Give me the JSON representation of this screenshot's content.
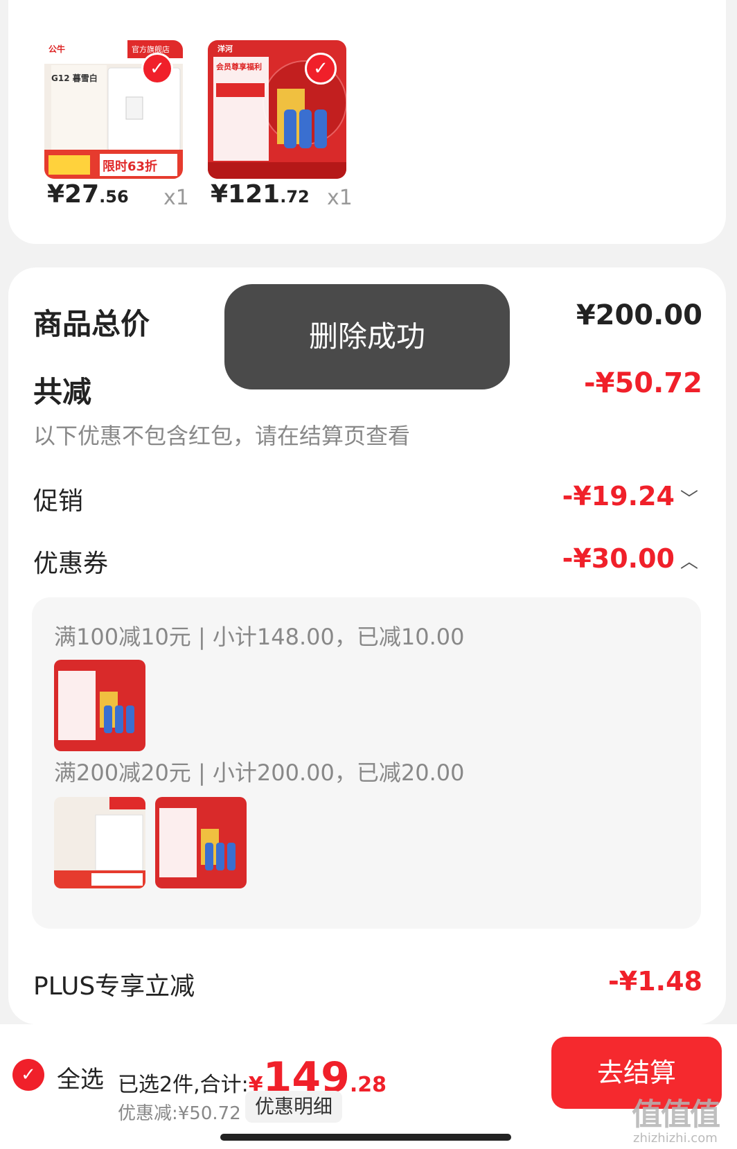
{
  "cart_items": [
    {
      "price_main": "¥27",
      "price_cents": ".56",
      "qty": "x1",
      "badge": "官方旗舰店",
      "brand": "公牛",
      "product_text": "G12 暮雪白",
      "promo_text": "限时63折"
    },
    {
      "price_main": "¥121",
      "price_cents": ".72",
      "qty": "x1",
      "brand": "洋河",
      "product_text": "会员尊享福利"
    }
  ],
  "summary": {
    "total_label": "商品总价",
    "total_value": "¥200.00",
    "reduce_label": "共减",
    "reduce_value": "-¥50.72",
    "hint": "以下优惠不包含红包，请在结算页查看",
    "promo_label": "促销",
    "promo_value": "-¥19.24",
    "coupon_label": "优惠券",
    "coupon_value": "-¥30.00",
    "plus_label": "PLUS专享立减",
    "plus_value": "-¥1.48"
  },
  "coupons": [
    {
      "title": "满100减10元 | 小计148.00，已减10.00"
    },
    {
      "title": "满200减20元 | 小计200.00，已减20.00"
    }
  ],
  "toast": "删除成功",
  "bottom": {
    "select_all": "全选",
    "selected_text": "已选2件,合计:",
    "currency": "¥",
    "total_int": "149",
    "total_cents": ".28",
    "discount_text": "优惠减:¥50.72",
    "detail_btn": "优惠明细",
    "checkout_btn": "去结算"
  },
  "watermark": {
    "main": "值值值",
    "sub": "zhizhizhi.com"
  },
  "colors": {
    "accent": "#f0202a",
    "toast_bg": "#4a4a4a",
    "page_bg": "#f2f2f2"
  },
  "icons": {
    "check": "check-icon",
    "chevron_down": "chevron-down-icon",
    "chevron_up": "chevron-up-icon"
  }
}
